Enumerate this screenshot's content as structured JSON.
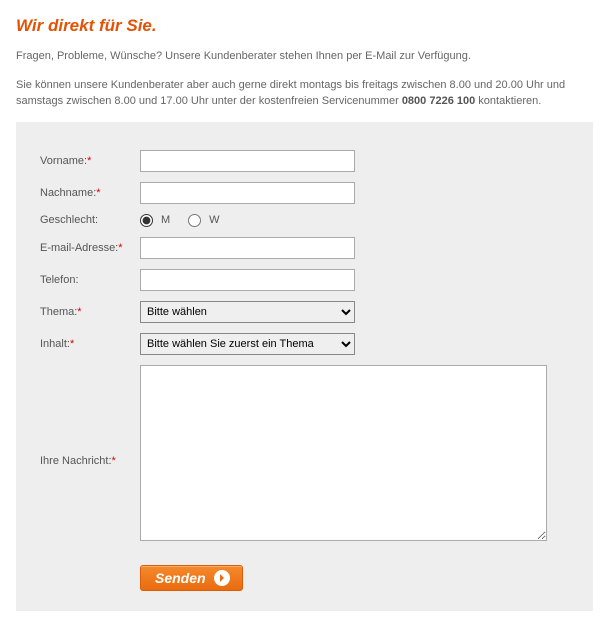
{
  "title": "Wir direkt für Sie.",
  "intro": {
    "line1": "Fragen, Probleme, Wünsche? Unsere Kundenberater stehen Ihnen per E-Mail zur Verfügung.",
    "line2a": "Sie können unsere Kundenberater aber auch gerne direkt montags bis freitags zwischen 8.00 und 20.00 Uhr und samstags zwischen 8.00 und 17.00 Uhr unter der kostenfreien Servicenummer ",
    "phone": "0800 7226 100",
    "line2b": " kontaktieren."
  },
  "form": {
    "vorname": {
      "label": "Vorname:",
      "value": ""
    },
    "nachname": {
      "label": "Nachname:",
      "value": ""
    },
    "geschlecht": {
      "label": "Geschlecht:",
      "m_label": "M",
      "w_label": "W",
      "selected": "M"
    },
    "email": {
      "label": "E-mail-Adresse:",
      "value": ""
    },
    "telefon": {
      "label": "Telefon:",
      "value": ""
    },
    "thema": {
      "label": "Thema:",
      "selected": "Bitte wählen"
    },
    "inhalt": {
      "label": "Inhalt:",
      "selected": "Bitte wählen Sie zuerst ein Thema"
    },
    "nachricht": {
      "label": "Ihre Nachricht:",
      "value": ""
    },
    "submit": "Senden"
  },
  "required_marker": "*"
}
